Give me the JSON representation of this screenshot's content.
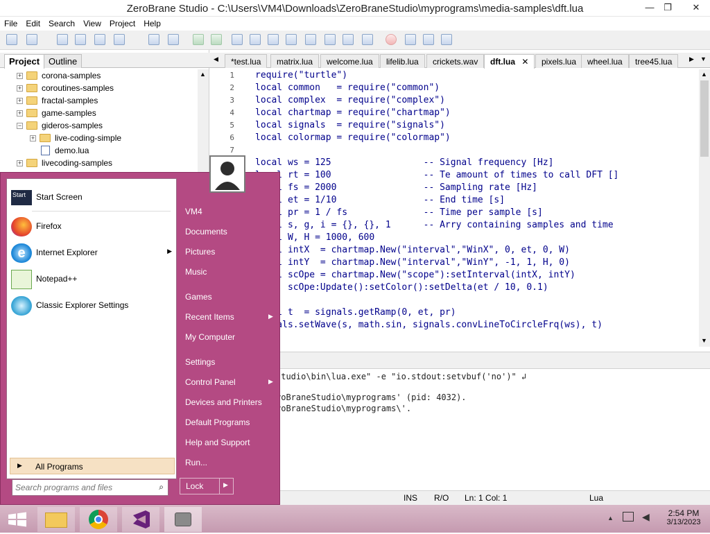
{
  "window": {
    "title": "ZeroBrane Studio - C:\\Users\\VM4\\Downloads\\ZeroBraneStudio\\myprograms\\media-samples\\dft.lua",
    "min_glyph": "—",
    "restore_glyph": "❐",
    "close_glyph": "✕"
  },
  "menu": [
    "File",
    "Edit",
    "Search",
    "View",
    "Project",
    "Help"
  ],
  "toolbar_icons": [
    "new-icon",
    "open-icon",
    "save-icon",
    "save-all-icon",
    "project-icon",
    "folder-icon",
    "find-icon",
    "replace-icon",
    "run-icon",
    "run-now-icon",
    "step-into-icon",
    "stop-icon",
    "step-over-icon",
    "pause-icon",
    "toggle-icon",
    "comment-icon",
    "indent-icon",
    "outdent-icon",
    "breakpoint-icon",
    "bookmark-icon",
    "watch-icon",
    "stack-icon"
  ],
  "left_panel": {
    "tabs": [
      "Project",
      "Outline"
    ],
    "tree": [
      {
        "label": "corona-samples",
        "type": "folder",
        "expander": "+",
        "indent": 0
      },
      {
        "label": "coroutines-samples",
        "type": "folder",
        "expander": "+",
        "indent": 0
      },
      {
        "label": "fractal-samples",
        "type": "folder",
        "expander": "+",
        "indent": 0
      },
      {
        "label": "game-samples",
        "type": "folder",
        "expander": "+",
        "indent": 0
      },
      {
        "label": "gideros-samples",
        "type": "folder",
        "expander": "−",
        "indent": 0
      },
      {
        "label": "live-coding-simple",
        "type": "folder",
        "expander": "+",
        "indent": 1
      },
      {
        "label": "demo.lua",
        "type": "file",
        "expander": "",
        "indent": 1
      },
      {
        "label": "livecoding-samples",
        "type": "folder",
        "expander": "+",
        "indent": 0
      }
    ]
  },
  "editor": {
    "tabs": [
      {
        "label": "test.lua",
        "prefix": "*",
        "active": false
      },
      {
        "label": "matrix.lua",
        "active": false
      },
      {
        "label": "welcome.lua",
        "active": false
      },
      {
        "label": "lifelib.lua",
        "active": false
      },
      {
        "label": "crickets.wav",
        "active": false
      },
      {
        "label": "dft.lua",
        "active": true,
        "close": "✕"
      },
      {
        "label": "pixels.lua",
        "active": false
      },
      {
        "label": "wheel.lua",
        "active": false
      },
      {
        "label": "tree45.lua",
        "active": false
      }
    ],
    "line_numbers": [
      "1",
      "2",
      "3",
      "4",
      "5",
      "6",
      "7"
    ],
    "code_lines": [
      "require(\"turtle\")",
      "local common   = require(\"common\")",
      "local complex  = require(\"complex\")",
      "local chartmap = require(\"chartmap\")",
      "local signals  = require(\"signals\")",
      "local colormap = require(\"colormap\")",
      "",
      "local ws = 125                 -- Signal frequency [Hz]",
      "local rt = 100                 -- Te amount of times to call DFT []",
      "local fs = 2000                -- Sampling rate [Hz]",
      "local et = 1/10                -- End time [s]",
      "local pr = 1 / fs              -- Time per sample [s]",
      "local s, g, i = {}, {}, 1      -- Arry containing samples and time",
      "local W, H = 1000, 600",
      "local intX  = chartmap.New(\"interval\",\"WinX\", 0, et, 0, W)",
      "local intY  = chartmap.New(\"interval\",\"WinY\", -1, 1, H, 0)",
      "local scOpe = chartmap.New(\"scope\"):setInterval(intX, intY)",
      "      scOpe:Update():setColor():setDelta(et / 10, 0.1)",
      "",
      "local t  = signals.getRamp(0, et, pr)",
      "signals.setWave(s, math.sin, signals.convLineToCircleFrq(ws), t)"
    ]
  },
  "output": {
    "lines": [
      "studio\\bin\\lua.exe\" -e \"io.stdout:setvbuf('no')\" ↲",
      "",
      "roBraneStudio\\myprograms' (pid: 4032).",
      "roBraneStudio\\myprograms\\'."
    ]
  },
  "status": {
    "mode": "INS",
    "access": "R/O",
    "position": "Ln: 1 Col: 1",
    "language": "Lua"
  },
  "start_menu": {
    "left_items": [
      {
        "label": "Start Screen",
        "icon": "start-screen-icon",
        "arrow": ""
      },
      {
        "label": "Firefox",
        "icon": "firefox-icon",
        "arrow": ""
      },
      {
        "label": "Internet Explorer",
        "icon": "internet-explorer-icon",
        "arrow": "▶"
      },
      {
        "label": "Notepad++",
        "icon": "notepad-plus-plus-icon",
        "arrow": ""
      },
      {
        "label": "Classic Explorer Settings",
        "icon": "classic-explorer-icon",
        "arrow": ""
      }
    ],
    "start_badge": "Start",
    "all_programs": "All Programs",
    "search_placeholder": "Search programs and files",
    "right_items": [
      {
        "label": "VM4",
        "arrow": ""
      },
      {
        "label": "Documents",
        "arrow": ""
      },
      {
        "label": "Pictures",
        "arrow": ""
      },
      {
        "label": "Music",
        "arrow": ""
      },
      {
        "label": "Games",
        "arrow": ""
      },
      {
        "label": "Recent Items",
        "arrow": "▶"
      },
      {
        "label": "My Computer",
        "arrow": ""
      },
      {
        "label": "Settings",
        "arrow": ""
      },
      {
        "label": "Control Panel",
        "arrow": "▶"
      },
      {
        "label": "Devices and Printers",
        "arrow": ""
      },
      {
        "label": "Default Programs",
        "arrow": ""
      },
      {
        "label": "Help and Support",
        "arrow": ""
      },
      {
        "label": "Run...",
        "arrow": ""
      }
    ],
    "lock": "Lock"
  },
  "taskbar": {
    "time": "2:54 PM",
    "date": "3/13/2023",
    "apps": [
      "start-button",
      "file-explorer-icon",
      "chrome-icon",
      "visual-studio-icon",
      "zerobrane-icon"
    ]
  },
  "colors": {
    "start_menu_bg": "#b44a83",
    "taskbar_bg": "#c59ab0",
    "keyword": "#00008b",
    "string": "#7a1fa2"
  }
}
